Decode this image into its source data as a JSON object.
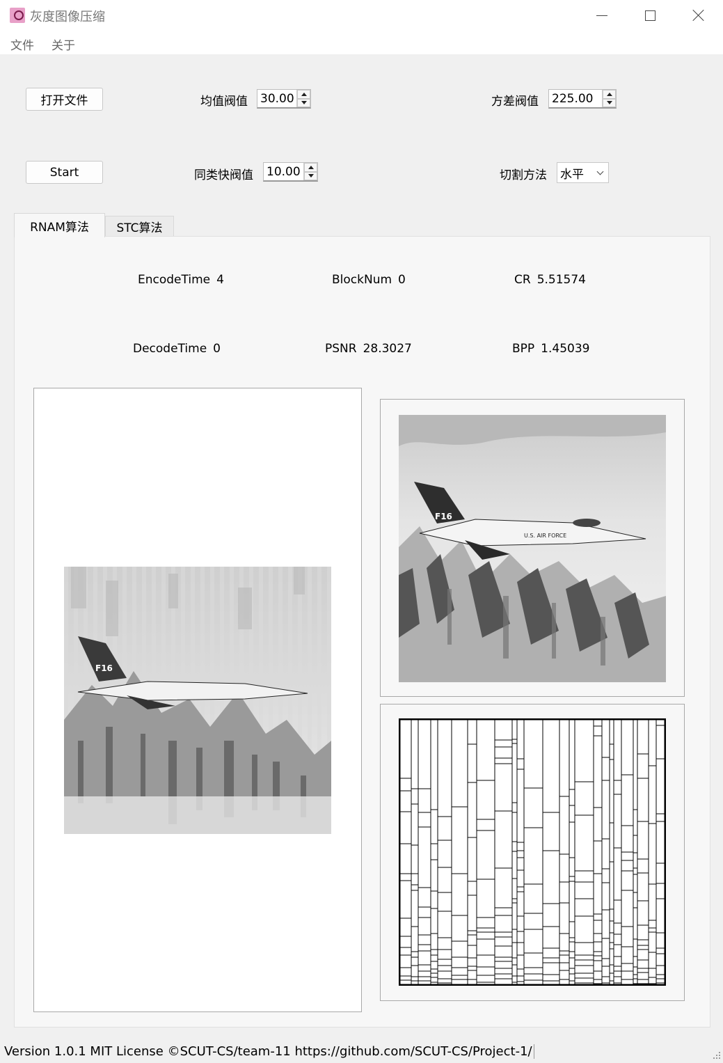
{
  "window": {
    "title": "灰度图像压缩",
    "app_icon": "picture-app-icon"
  },
  "menu": {
    "items": [
      "文件",
      "关于"
    ]
  },
  "controls": {
    "open_file_label": "打开文件",
    "start_label": "Start",
    "mean_threshold_label": "均值阀值",
    "mean_threshold_value": "30.00",
    "variance_threshold_label": "方差阀值",
    "variance_threshold_value": "225.00",
    "similar_block_threshold_label": "同类快阀值",
    "similar_block_threshold_value": "10.00",
    "split_method_label": "切割方法",
    "split_method_value": "水平"
  },
  "tabs": {
    "items": [
      "RNAM算法",
      "STC算法"
    ],
    "active": "RNAM算法"
  },
  "stats": {
    "encode_time_label": "EncodeTime",
    "encode_time_value": "4",
    "block_num_label": "BlockNum",
    "block_num_value": "0",
    "cr_label": "CR",
    "cr_value": "5.51574",
    "decode_time_label": "DecodeTime",
    "decode_time_value": "0",
    "psnr_label": "PSNR",
    "psnr_value": "28.3027",
    "bpp_label": "BPP",
    "bpp_value": "1.45039"
  },
  "images": {
    "decoded_image": "grayscale F-16 jet over snowy mountains (reconstructed, vertical block artifacts)",
    "original_image": "grayscale F-16 jet over snowy mountains (original)",
    "segmentation_image": "rectangular block partition map, black outlines on white"
  },
  "status": {
    "text": "Version 1.0.1 MIT License ©SCUT-CS/team-11 https://github.com/SCUT-CS/Project-1/"
  },
  "colors": {
    "window_bg": "#f0f0f0",
    "panel_bg": "#f7f7f7",
    "app_icon_bg": "#e8a0c8"
  }
}
